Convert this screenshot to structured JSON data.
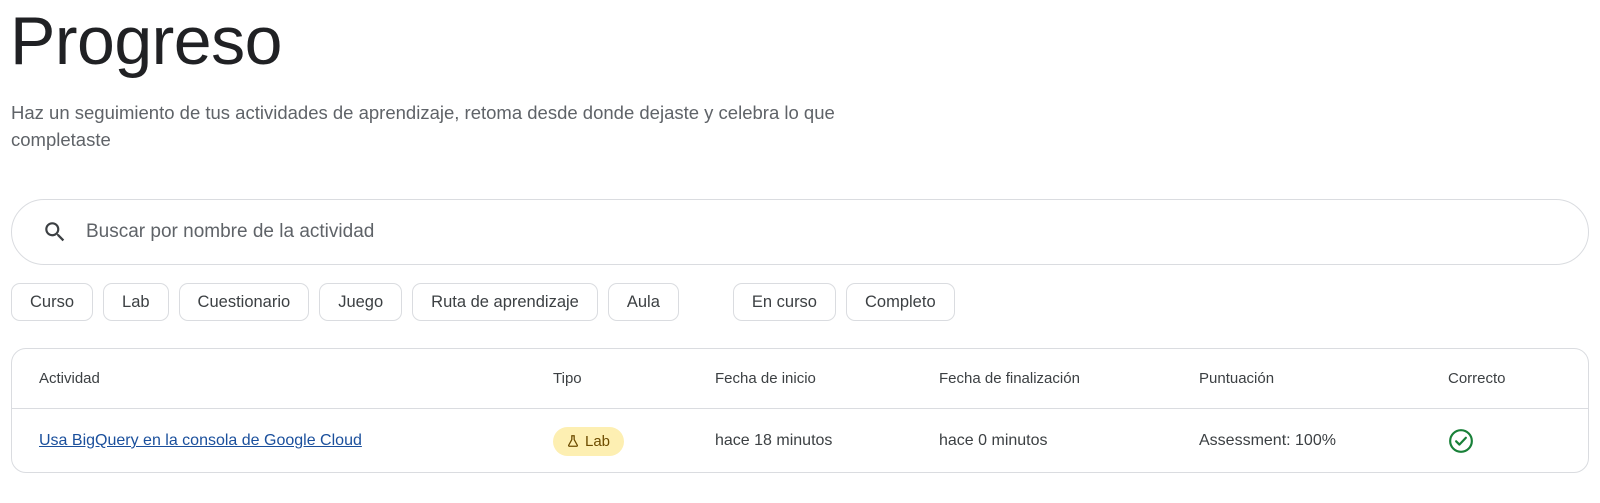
{
  "header": {
    "title": "Progreso",
    "subtitle": "Haz un seguimiento de tus actividades de aprendizaje, retoma desde donde dejaste y celebra lo que completaste"
  },
  "search": {
    "placeholder": "Buscar por nombre de la actividad",
    "value": "",
    "icon": "search-icon"
  },
  "filters": {
    "type_chips": [
      "Curso",
      "Lab",
      "Cuestionario",
      "Juego",
      "Ruta de aprendizaje",
      "Aula"
    ],
    "status_chips": [
      "En curso",
      "Completo"
    ]
  },
  "table": {
    "columns": [
      "Actividad",
      "Tipo",
      "Fecha de inicio",
      "Fecha de finalización",
      "Puntuación",
      "Correcto"
    ],
    "rows": [
      {
        "activity": "Usa BigQuery en la consola de Google Cloud",
        "type": "Lab",
        "type_icon": "flask-icon",
        "start": "hace 18 minutos",
        "end": "hace 0 minutos",
        "score": "Assessment: 100%",
        "passed_icon": "check-circle-icon"
      }
    ]
  },
  "colors": {
    "link": "#1a4f9c",
    "badge_bg": "#fdefb2",
    "badge_text": "#6d4c00",
    "success": "#188038",
    "border": "#dadce0"
  }
}
